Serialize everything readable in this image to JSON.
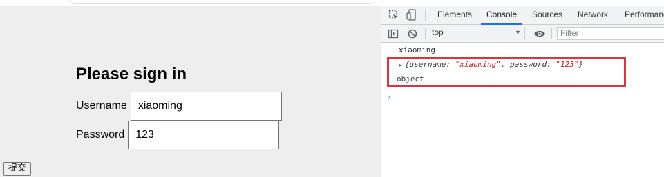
{
  "page": {
    "heading": "Please sign in",
    "username_label": "Username",
    "username_value": "xiaoming",
    "password_label": "Password",
    "password_value": "123",
    "submit_label": "提交"
  },
  "devtools": {
    "tabs": [
      "Elements",
      "Console",
      "Sources",
      "Network",
      "Performanc"
    ],
    "active_tab": "Console",
    "context": "top",
    "filter_placeholder": "Filter",
    "icons": {
      "inspect": "inspect-element-icon",
      "device": "device-toolbar-icon",
      "sidebar": "console-sidebar-icon",
      "clear": "clear-console-icon",
      "eye": "live-expression-icon",
      "caret": "dropdown-caret-icon",
      "prompt": "console-prompt-icon"
    }
  },
  "console": {
    "line1": "xiaoming",
    "object_open": "{username: ",
    "object_username": "\"xiaoming\"",
    "object_mid": ", password: ",
    "object_password": "\"123\"",
    "object_close": "}",
    "line3": "object",
    "prompt_glyph": "›"
  },
  "colors": {
    "page_bg": "#eeeeee",
    "highlight": "#e0323b",
    "accent": "#1a73e8",
    "string": "#c41a16"
  }
}
